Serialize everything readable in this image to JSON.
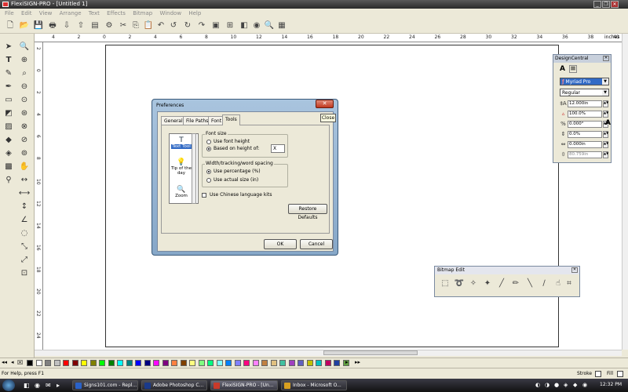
{
  "window": {
    "title": "FlexiSIGN-PRO - [Untitled 1]",
    "minimize": "_",
    "restore": "❐",
    "close": "✕"
  },
  "menu": [
    "File",
    "Edit",
    "View",
    "Arrange",
    "Text",
    "Effects",
    "Bitmap",
    "Window",
    "Help"
  ],
  "ruler": {
    "unit_label": "inches",
    "h_ticks": [
      "4",
      "2",
      "0",
      "2",
      "4",
      "6",
      "8",
      "10",
      "12",
      "14",
      "16",
      "18",
      "20",
      "22",
      "24",
      "26",
      "28",
      "30",
      "32",
      "34",
      "36",
      "38",
      "40"
    ],
    "v_ticks": [
      "2",
      "0",
      "2",
      "4",
      "6",
      "8",
      "10",
      "12",
      "14",
      "16",
      "18",
      "20",
      "22",
      "24"
    ]
  },
  "preferences": {
    "title": "Preferences",
    "tabs": [
      "General",
      "File Paths",
      "Font",
      "Tools"
    ],
    "active_tab": "Tools",
    "tool_list": [
      {
        "icon": "T",
        "label": "Text Tool",
        "selected": true
      },
      {
        "icon": "💡",
        "label": "Tip of the day",
        "selected": false
      },
      {
        "icon": "🔍",
        "label": "Zoom",
        "selected": false
      }
    ],
    "font_size": {
      "legend": "Font size",
      "opt_height": "Use font height",
      "opt_based": "Based on height of:",
      "based_value": "X"
    },
    "spacing": {
      "legend": "Width/tracking/word spacing",
      "opt_percent": "Use percentage (%)",
      "opt_actual": "Use actual size (in)"
    },
    "chinese_kits": "Use Chinese language kits",
    "restore_defaults": "Restore Defaults",
    "ok": "OK",
    "cancel": "Cancel",
    "close_tooltip": "Close"
  },
  "design_central": {
    "title": "DesignCentral",
    "font": "Myriad Pro",
    "style": "Regular",
    "rows": [
      {
        "icon": "‡A",
        "value": "12.000in"
      },
      {
        "icon": "▵",
        "value": "100.0%"
      },
      {
        "icon": "%",
        "value": "0.000°"
      },
      {
        "icon": "⇕",
        "value": "0.0%"
      },
      {
        "icon": "⇔",
        "value": "0.000in"
      },
      {
        "icon": "⇳",
        "value": "80.759in"
      }
    ]
  },
  "bitmap_edit": {
    "title": "Bitmap Edit"
  },
  "palette": {
    "colors": [
      "#000000",
      "#ffffff",
      "#808080",
      "#c0c0c0",
      "#ff0000",
      "#800000",
      "#ffff00",
      "#808000",
      "#00ff00",
      "#008000",
      "#00ffff",
      "#008080",
      "#0000ff",
      "#000080",
      "#ff00ff",
      "#800080",
      "#ff8040",
      "#804000",
      "#ffff80",
      "#80ff80",
      "#00ff80",
      "#80ffff",
      "#0080ff",
      "#8080ff",
      "#ff0080",
      "#ff80ff",
      "#c08040",
      "#e0c080",
      "#40c0a0",
      "#a040c0",
      "#6060c0",
      "#c0c000",
      "#00c0c0",
      "#c00060",
      "#2040a0",
      "#60a040"
    ]
  },
  "status": {
    "help": "For Help, press F1",
    "stroke": "Stroke",
    "fill": "Fill"
  },
  "taskbar": {
    "tasks": [
      {
        "label": "Signs101.com - Repl...",
        "color": "#2a62c8"
      },
      {
        "label": "Adobe Photoshop C...",
        "color": "#1a3a8a"
      },
      {
        "label": "FlexiSIGN-PRO - [Un...",
        "color": "#c83a2a"
      },
      {
        "label": "Inbox - Microsoft O...",
        "color": "#d8a020"
      }
    ],
    "time": "12:32 PM"
  }
}
